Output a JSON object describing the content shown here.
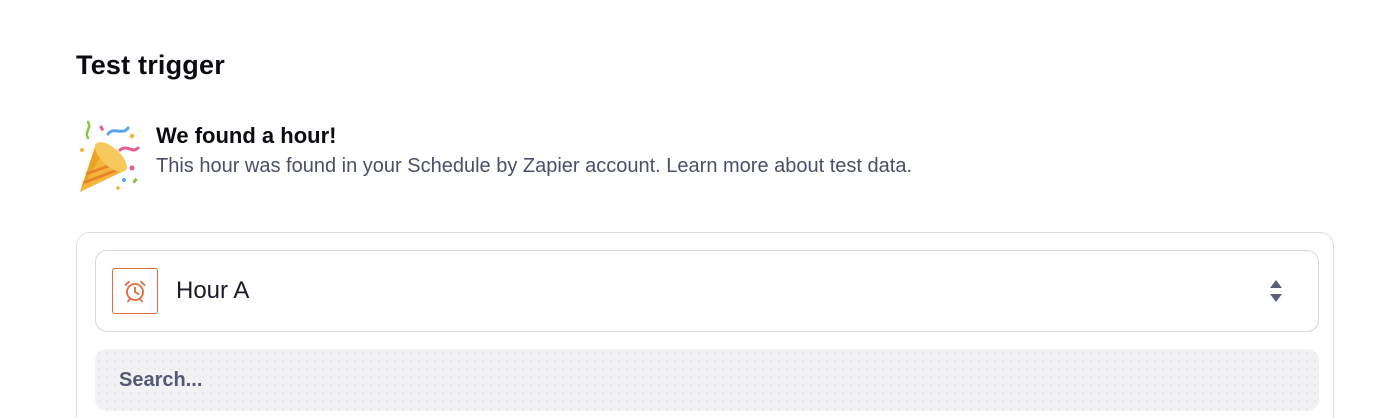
{
  "header": {
    "title": "Test trigger"
  },
  "result": {
    "title": "We found a hour!",
    "description": "This hour was found in your Schedule by Zapier account.",
    "link_text": "Learn more about test data.",
    "icon": "party-popper-icon"
  },
  "selector": {
    "selected_value": "Hour A",
    "app_icon": "alarm-clock-icon",
    "toggle_icon": "sort-arrows-icon"
  },
  "search": {
    "placeholder": "Search..."
  },
  "colors": {
    "accent": "#e06b3f",
    "muted_text": "#4a4f6a",
    "border": "#dcdce3"
  }
}
